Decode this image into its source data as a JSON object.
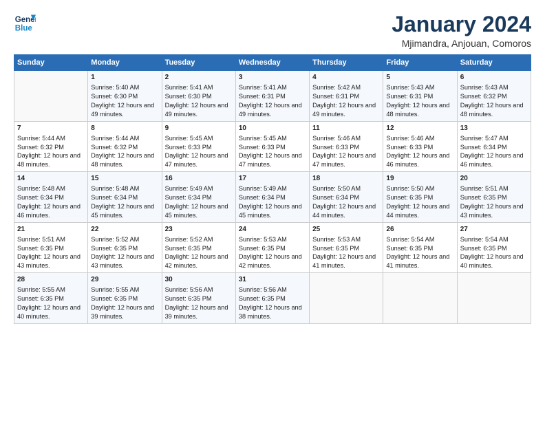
{
  "logo": {
    "line1": "General",
    "line2": "Blue"
  },
  "title": "January 2024",
  "subtitle": "Mjimandra, Anjouan, Comoros",
  "days_header": [
    "Sunday",
    "Monday",
    "Tuesday",
    "Wednesday",
    "Thursday",
    "Friday",
    "Saturday"
  ],
  "weeks": [
    [
      {
        "day": "",
        "sunrise": "",
        "sunset": "",
        "daylight": ""
      },
      {
        "day": "1",
        "sunrise": "Sunrise: 5:40 AM",
        "sunset": "Sunset: 6:30 PM",
        "daylight": "Daylight: 12 hours and 49 minutes."
      },
      {
        "day": "2",
        "sunrise": "Sunrise: 5:41 AM",
        "sunset": "Sunset: 6:30 PM",
        "daylight": "Daylight: 12 hours and 49 minutes."
      },
      {
        "day": "3",
        "sunrise": "Sunrise: 5:41 AM",
        "sunset": "Sunset: 6:31 PM",
        "daylight": "Daylight: 12 hours and 49 minutes."
      },
      {
        "day": "4",
        "sunrise": "Sunrise: 5:42 AM",
        "sunset": "Sunset: 6:31 PM",
        "daylight": "Daylight: 12 hours and 49 minutes."
      },
      {
        "day": "5",
        "sunrise": "Sunrise: 5:43 AM",
        "sunset": "Sunset: 6:31 PM",
        "daylight": "Daylight: 12 hours and 48 minutes."
      },
      {
        "day": "6",
        "sunrise": "Sunrise: 5:43 AM",
        "sunset": "Sunset: 6:32 PM",
        "daylight": "Daylight: 12 hours and 48 minutes."
      }
    ],
    [
      {
        "day": "7",
        "sunrise": "Sunrise: 5:44 AM",
        "sunset": "Sunset: 6:32 PM",
        "daylight": "Daylight: 12 hours and 48 minutes."
      },
      {
        "day": "8",
        "sunrise": "Sunrise: 5:44 AM",
        "sunset": "Sunset: 6:32 PM",
        "daylight": "Daylight: 12 hours and 48 minutes."
      },
      {
        "day": "9",
        "sunrise": "Sunrise: 5:45 AM",
        "sunset": "Sunset: 6:33 PM",
        "daylight": "Daylight: 12 hours and 47 minutes."
      },
      {
        "day": "10",
        "sunrise": "Sunrise: 5:45 AM",
        "sunset": "Sunset: 6:33 PM",
        "daylight": "Daylight: 12 hours and 47 minutes."
      },
      {
        "day": "11",
        "sunrise": "Sunrise: 5:46 AM",
        "sunset": "Sunset: 6:33 PM",
        "daylight": "Daylight: 12 hours and 47 minutes."
      },
      {
        "day": "12",
        "sunrise": "Sunrise: 5:46 AM",
        "sunset": "Sunset: 6:33 PM",
        "daylight": "Daylight: 12 hours and 46 minutes."
      },
      {
        "day": "13",
        "sunrise": "Sunrise: 5:47 AM",
        "sunset": "Sunset: 6:34 PM",
        "daylight": "Daylight: 12 hours and 46 minutes."
      }
    ],
    [
      {
        "day": "14",
        "sunrise": "Sunrise: 5:48 AM",
        "sunset": "Sunset: 6:34 PM",
        "daylight": "Daylight: 12 hours and 46 minutes."
      },
      {
        "day": "15",
        "sunrise": "Sunrise: 5:48 AM",
        "sunset": "Sunset: 6:34 PM",
        "daylight": "Daylight: 12 hours and 45 minutes."
      },
      {
        "day": "16",
        "sunrise": "Sunrise: 5:49 AM",
        "sunset": "Sunset: 6:34 PM",
        "daylight": "Daylight: 12 hours and 45 minutes."
      },
      {
        "day": "17",
        "sunrise": "Sunrise: 5:49 AM",
        "sunset": "Sunset: 6:34 PM",
        "daylight": "Daylight: 12 hours and 45 minutes."
      },
      {
        "day": "18",
        "sunrise": "Sunrise: 5:50 AM",
        "sunset": "Sunset: 6:34 PM",
        "daylight": "Daylight: 12 hours and 44 minutes."
      },
      {
        "day": "19",
        "sunrise": "Sunrise: 5:50 AM",
        "sunset": "Sunset: 6:35 PM",
        "daylight": "Daylight: 12 hours and 44 minutes."
      },
      {
        "day": "20",
        "sunrise": "Sunrise: 5:51 AM",
        "sunset": "Sunset: 6:35 PM",
        "daylight": "Daylight: 12 hours and 43 minutes."
      }
    ],
    [
      {
        "day": "21",
        "sunrise": "Sunrise: 5:51 AM",
        "sunset": "Sunset: 6:35 PM",
        "daylight": "Daylight: 12 hours and 43 minutes."
      },
      {
        "day": "22",
        "sunrise": "Sunrise: 5:52 AM",
        "sunset": "Sunset: 6:35 PM",
        "daylight": "Daylight: 12 hours and 43 minutes."
      },
      {
        "day": "23",
        "sunrise": "Sunrise: 5:52 AM",
        "sunset": "Sunset: 6:35 PM",
        "daylight": "Daylight: 12 hours and 42 minutes."
      },
      {
        "day": "24",
        "sunrise": "Sunrise: 5:53 AM",
        "sunset": "Sunset: 6:35 PM",
        "daylight": "Daylight: 12 hours and 42 minutes."
      },
      {
        "day": "25",
        "sunrise": "Sunrise: 5:53 AM",
        "sunset": "Sunset: 6:35 PM",
        "daylight": "Daylight: 12 hours and 41 minutes."
      },
      {
        "day": "26",
        "sunrise": "Sunrise: 5:54 AM",
        "sunset": "Sunset: 6:35 PM",
        "daylight": "Daylight: 12 hours and 41 minutes."
      },
      {
        "day": "27",
        "sunrise": "Sunrise: 5:54 AM",
        "sunset": "Sunset: 6:35 PM",
        "daylight": "Daylight: 12 hours and 40 minutes."
      }
    ],
    [
      {
        "day": "28",
        "sunrise": "Sunrise: 5:55 AM",
        "sunset": "Sunset: 6:35 PM",
        "daylight": "Daylight: 12 hours and 40 minutes."
      },
      {
        "day": "29",
        "sunrise": "Sunrise: 5:55 AM",
        "sunset": "Sunset: 6:35 PM",
        "daylight": "Daylight: 12 hours and 39 minutes."
      },
      {
        "day": "30",
        "sunrise": "Sunrise: 5:56 AM",
        "sunset": "Sunset: 6:35 PM",
        "daylight": "Daylight: 12 hours and 39 minutes."
      },
      {
        "day": "31",
        "sunrise": "Sunrise: 5:56 AM",
        "sunset": "Sunset: 6:35 PM",
        "daylight": "Daylight: 12 hours and 38 minutes."
      },
      {
        "day": "",
        "sunrise": "",
        "sunset": "",
        "daylight": ""
      },
      {
        "day": "",
        "sunrise": "",
        "sunset": "",
        "daylight": ""
      },
      {
        "day": "",
        "sunrise": "",
        "sunset": "",
        "daylight": ""
      }
    ]
  ]
}
